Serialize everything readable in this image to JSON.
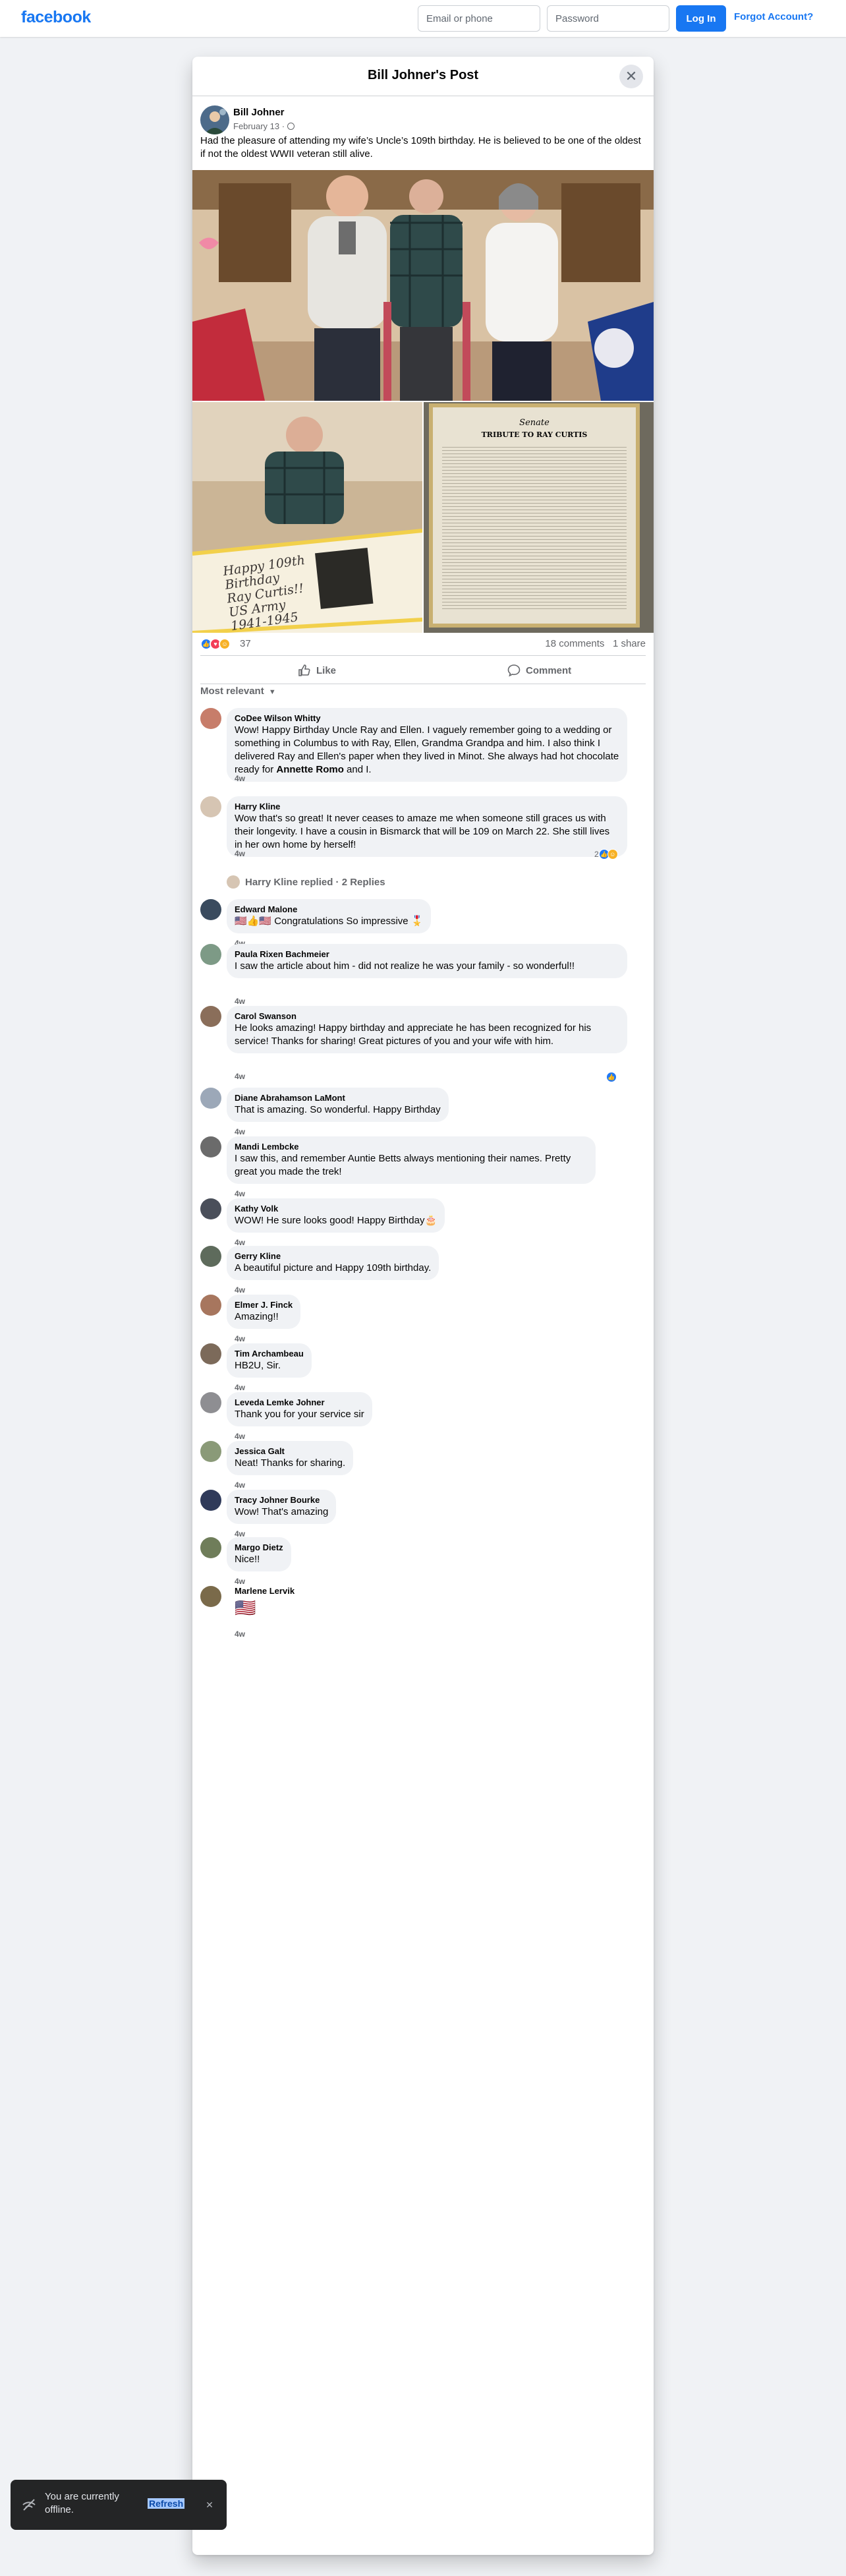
{
  "topbar": {
    "logo": "facebook",
    "email_placeholder": "Email or phone",
    "password_placeholder": "Password",
    "login_label": "Log In",
    "forgot_label": "Forgot Account?"
  },
  "modal": {
    "title": "Bill Johner's Post",
    "close_icon": "close-icon"
  },
  "post": {
    "author": "Bill Johner",
    "date": "February 13",
    "date_suffix": "·",
    "privacy_icon": "globe-icon",
    "text": "Had the pleasure of attending my wife’s Uncle’s 109th birthday.  He is believed to be one of the oldest if not the oldest WWII veteran still alive.",
    "cake_lines": [
      "Happy 109th",
      "Birthday",
      "Ray Curtis!!",
      "US Army",
      "1941-1945"
    ],
    "doc": {
      "header": "Senate",
      "title": "TRIBUTE TO RAY CURTIS"
    },
    "reaction_count": "37",
    "comments_count": "18 comments",
    "shares_count": "1 share",
    "like_label": "Like",
    "comment_label": "Comment",
    "sort_label": "Most relevant"
  },
  "comments": [
    {
      "name": "CoDee Wilson Whitty",
      "text_before": "Wow! Happy Birthday Uncle Ray and Ellen. I vaguely remember going to a wedding or something in Columbus to with Ray, Ellen, Grandma Grandpa and him. I also think I delivered Ray and Ellen's paper when they lived in Minot. She always had hot chocolate ready for ",
      "mention": "Annette Romo",
      "text_after": " and I.",
      "time": "4w"
    },
    {
      "name": "Harry Kline",
      "text": "Wow that's so great! It never ceases to amaze me when someone still graces us with their longevity. I have a cousin in Bismarck that will be 109 on March 22. She still lives in her own home by herself!",
      "time": "4w",
      "reacts": "2"
    },
    {
      "name": "Edward Malone",
      "text": "🇺🇸👍🇺🇸 Congratulations So impressive 🎖️",
      "time": "4w"
    },
    {
      "name": "Paula Rixen Bachmeier",
      "text": "I saw the article about him - did not realize he was your family - so wonderful!!",
      "time": "4w"
    },
    {
      "name": "Carol Swanson",
      "text": "He looks amazing! Happy birthday and appreciate he has been recognized for his service! Thanks for sharing! Great pictures of you and your wife with him.",
      "time": "4w"
    },
    {
      "name": "Diane Abrahamson LaMont",
      "text": "That is amazing. So wonderful. Happy Birthday",
      "time": "4w"
    },
    {
      "name": "Mandi Lembcke",
      "text": "I saw this, and remember Auntie Betts always mentioning their names. Pretty great you made the trek!",
      "time": "4w"
    },
    {
      "name": "Kathy Volk",
      "text": "WOW! He sure looks good! Happy Birthday🎂",
      "time": "4w"
    },
    {
      "name": "Gerry Kline",
      "text": "A beautiful picture and Happy 109th birthday.",
      "time": "4w"
    },
    {
      "name": "Elmer J. Finck",
      "text": "Amazing!!",
      "time": "4w"
    },
    {
      "name": "Tim Archambeau",
      "text": "HB2U, Sir.",
      "time": "4w"
    },
    {
      "name": "Leveda Lemke Johner",
      "text": "Thank you for your service sir",
      "time": "4w"
    },
    {
      "name": "Jessica Galt",
      "text": "Neat! Thanks for sharing.",
      "time": "4w"
    },
    {
      "name": "Tracy Johner Bourke",
      "text": "Wow! That's amazing",
      "time": "4w"
    },
    {
      "name": "Margo Dietz",
      "text": "Nice!!",
      "time": "4w"
    },
    {
      "name": "Marlene Lervik",
      "text": "🇺🇸",
      "time": "4w"
    }
  ],
  "replies": {
    "label": "Harry Kline replied · 2 Replies"
  },
  "toast": {
    "text": "You are currently offline.",
    "action": "Refresh",
    "close_icon": "close-icon",
    "icon": "offline-icon"
  },
  "colors": {
    "brand": "#1877f2",
    "like": "#2078f4",
    "love": "#f33e58",
    "care": "#f7b125"
  }
}
